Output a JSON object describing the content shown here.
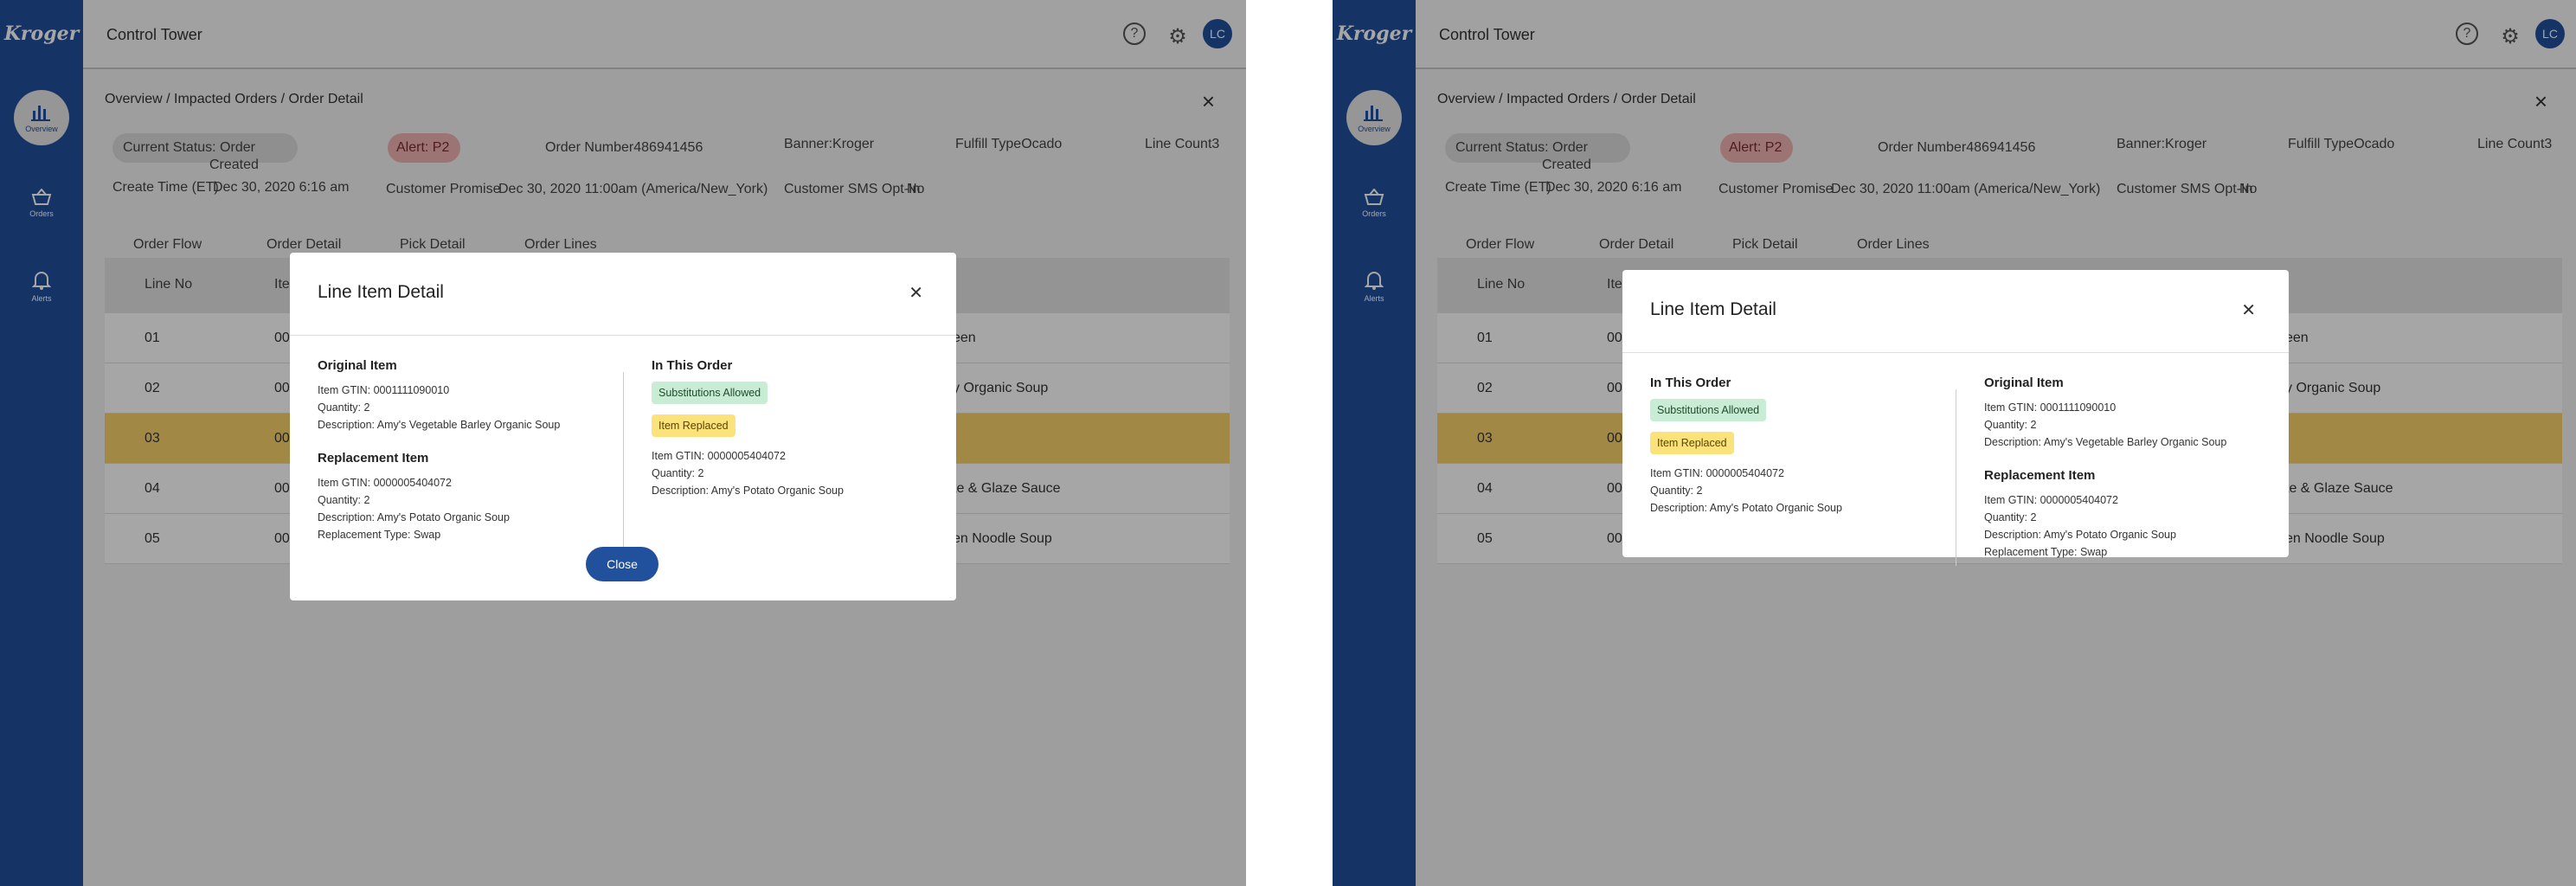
{
  "sidebar": {
    "logo": "Kroger",
    "items": [
      {
        "label": "Overview"
      },
      {
        "label": "Orders"
      },
      {
        "label": "Alerts"
      }
    ]
  },
  "header": {
    "title": "Control Tower",
    "avatar_initials": "LC"
  },
  "breadcrumb": "Overview / Impacted Orders / Order Detail",
  "order": {
    "status_label": "Current Status: Order",
    "status_value": "Created",
    "alert": "Alert: P2",
    "order_number_label": "Order Number",
    "order_number": "486941456",
    "banner_label": "Banner:",
    "banner": "Kroger",
    "fulfill_label": "Fulfill Type",
    "fulfill": "Ocado",
    "line_count_label": "Line Count",
    "line_count": "3",
    "create_time_label": "Create Time (ET)",
    "create_time": "Dec 30, 2020 6:16 am",
    "promise_label": "Customer Promise",
    "promise": "Dec 30, 2020 11:00am (America/New_York)",
    "sms_label": "Customer SMS Opt-In",
    "sms": "No"
  },
  "tabs": [
    "Order Flow",
    "Order Detail",
    "Pick Detail",
    "Order Lines"
  ],
  "table": {
    "headers": [
      "Line No",
      "Ite"
    ],
    "rows": [
      {
        "line": "01",
        "item": "00",
        "desc": "een"
      },
      {
        "line": "02",
        "item": "00",
        "desc": "y Organic Soup"
      },
      {
        "line": "03",
        "item": "00",
        "desc": ""
      },
      {
        "line": "04",
        "item": "000",
        "desc": "te & Glaze Sauce"
      },
      {
        "line": "05",
        "item": "000",
        "desc": "en Noodle Soup"
      }
    ]
  },
  "modal": {
    "title": "Line Item Detail",
    "original": {
      "title": "Original Item",
      "gtin": "Item GTIN: 0001111090010",
      "qty": "Quantity: 2",
      "desc": "Description: Amy's Vegetable Barley Organic Soup"
    },
    "replacement": {
      "title": "Replacement Item",
      "gtin": "Item GTIN: 0000005404072",
      "qty": "Quantity: 2",
      "desc": "Description: Amy's Potato Organic Soup",
      "type": "Replacement Type: Swap"
    },
    "in_order": {
      "title": "In This Order",
      "badge_subs": "Substitutions Allowed",
      "badge_replaced": "Item Replaced",
      "gtin": "Item GTIN: 0000005404072",
      "qty": "Quantity: 2",
      "desc": "Description: Amy's Potato Organic Soup"
    },
    "close_button": "Close"
  },
  "colors": {
    "sidebar": "#21509c",
    "highlight_row": "#f7d36b",
    "badge_green": "#c9ecd4",
    "badge_yellow": "#fbe27a",
    "alert": "#f0b3b3"
  }
}
